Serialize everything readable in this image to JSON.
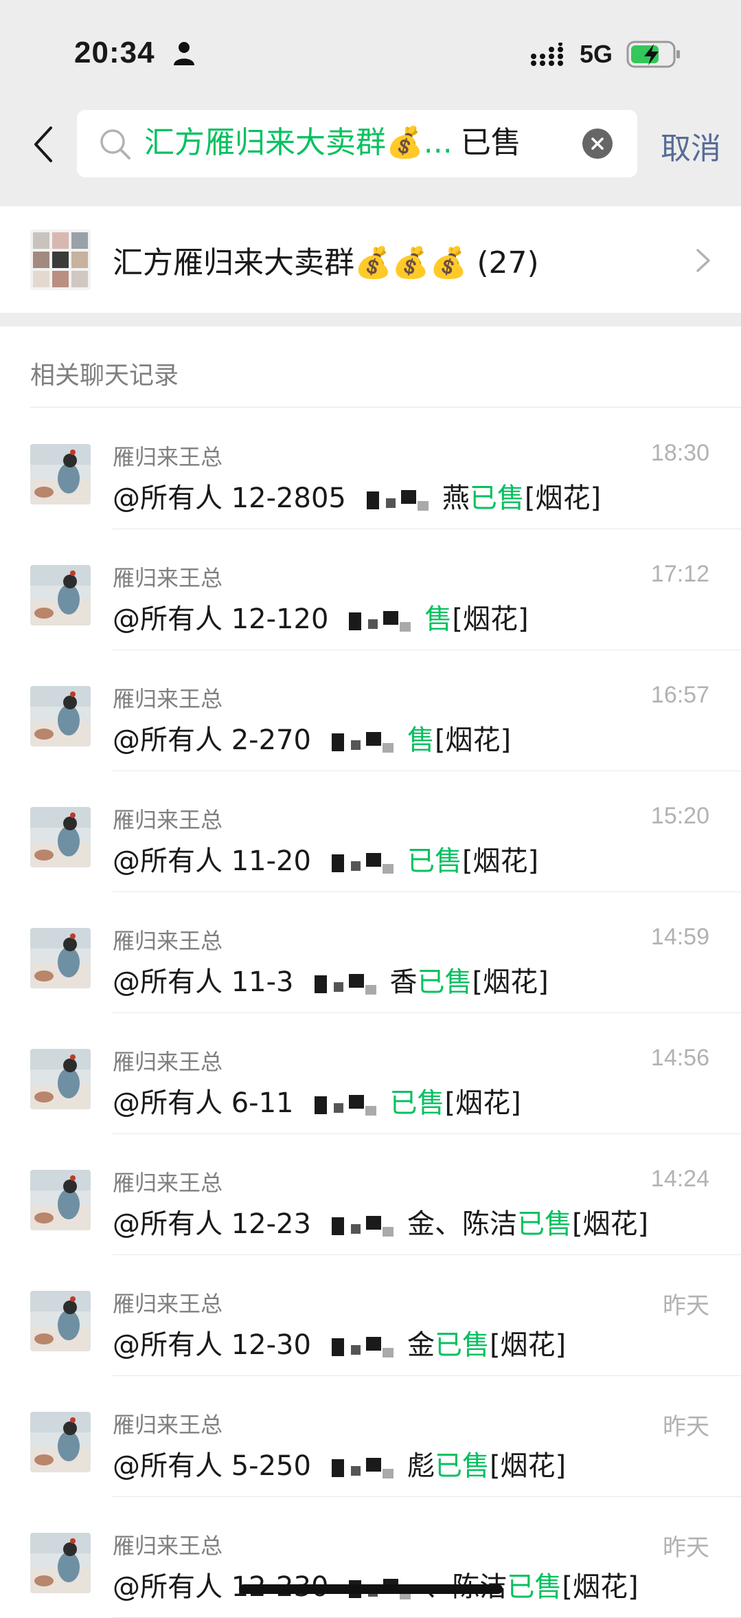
{
  "status_bar": {
    "time": "20:34",
    "network": "5G",
    "icons": [
      "person-icon",
      "signal-icon",
      "battery-charging-icon"
    ],
    "colors": {
      "battery_fill": "#34c759"
    }
  },
  "search": {
    "tag_text": "汇方雁归来大卖群💰...",
    "keyword": "已售",
    "cancel_label": "取消",
    "colors": {
      "tag": "#07c160",
      "cancel": "#576b95",
      "background": "#ededed"
    }
  },
  "group": {
    "name": "汇方雁归来大卖群💰💰💰 (27)"
  },
  "section": {
    "title": "相关聊天记录"
  },
  "results": [
    {
      "sender": "雁归来王总",
      "time": "18:30",
      "prefix": "@所有人 12-2805",
      "suffix_plain": "燕",
      "highlight": "已售",
      "tail": "[烟花]"
    },
    {
      "sender": "雁归来王总",
      "time": "17:12",
      "prefix": "@所有人 12-120",
      "suffix_plain": "",
      "highlight": "售",
      "tail": "[烟花]"
    },
    {
      "sender": "雁归来王总",
      "time": "16:57",
      "prefix": "@所有人 2-270",
      "suffix_plain": "",
      "highlight": "售",
      "tail": "[烟花]"
    },
    {
      "sender": "雁归来王总",
      "time": "15:20",
      "prefix": "@所有人 11-20",
      "suffix_plain": "",
      "highlight": "已售",
      "tail": "[烟花]"
    },
    {
      "sender": "雁归来王总",
      "time": "14:59",
      "prefix": "@所有人 11-3",
      "suffix_plain": "香",
      "highlight": "已售",
      "tail": "[烟花]"
    },
    {
      "sender": "雁归来王总",
      "time": "14:56",
      "prefix": "@所有人 6-11",
      "suffix_plain": "",
      "highlight": "已售",
      "tail": "[烟花]"
    },
    {
      "sender": "雁归来王总",
      "time": "14:24",
      "prefix": "@所有人 12-23",
      "suffix_plain": "金、陈洁",
      "highlight": "已售",
      "tail": "[烟花]"
    },
    {
      "sender": "雁归来王总",
      "time": "昨天",
      "prefix": "@所有人 12-30",
      "suffix_plain": "金",
      "highlight": "已售",
      "tail": "[烟花]"
    },
    {
      "sender": "雁归来王总",
      "time": "昨天",
      "prefix": "@所有人 5-250",
      "suffix_plain": "彪",
      "highlight": "已售",
      "tail": "[烟花]"
    },
    {
      "sender": "雁归来王总",
      "time": "昨天",
      "prefix": "@所有人 12-230",
      "suffix_plain": "、陈洁",
      "highlight": "已售",
      "tail": "[烟花]"
    }
  ]
}
